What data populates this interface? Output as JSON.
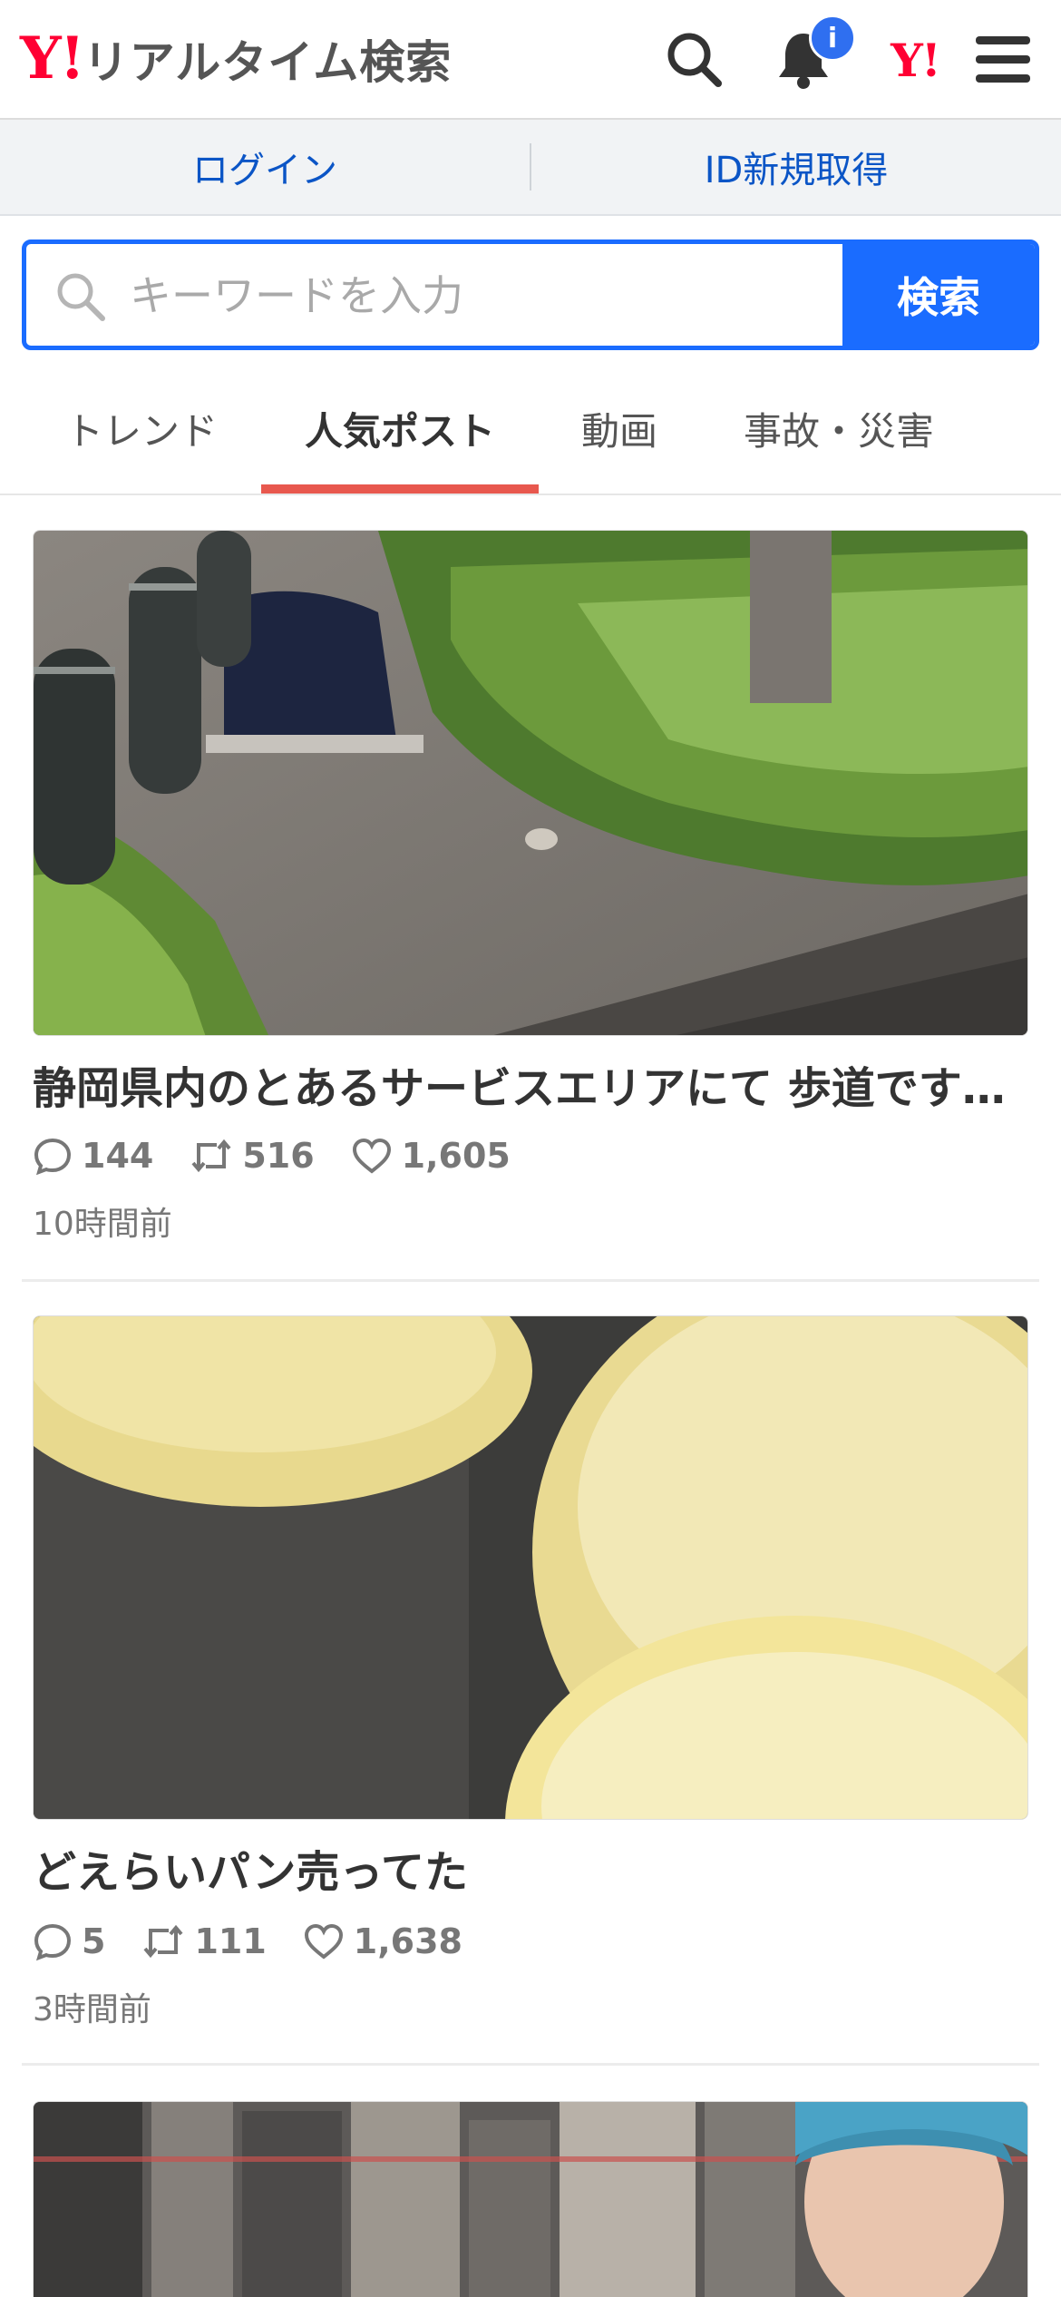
{
  "header": {
    "logo_mark": "Y!",
    "logo_text": "リアルタイム検索",
    "notification_badge": "i",
    "yahoo_mark": "Y!",
    "icons": [
      "search-icon",
      "bell-icon",
      "yahoo-logo-icon",
      "menu-icon"
    ]
  },
  "login_bar": {
    "login_label": "ログイン",
    "register_label": "ID新規取得"
  },
  "search": {
    "placeholder": "キーワードを入力",
    "button_label": "検索"
  },
  "tabs": [
    {
      "label": "トレンド",
      "active": false
    },
    {
      "label": "人気ポスト",
      "active": true
    },
    {
      "label": "動画",
      "active": false
    },
    {
      "label": "事故・災害",
      "active": false
    }
  ],
  "posts": [
    {
      "title": "静岡県内のとあるサービスエリアにて 歩道です…",
      "replies": "144",
      "reposts": "516",
      "likes": "1,605",
      "time": "10時間前"
    },
    {
      "title": "どえらいパン売ってた",
      "replies": "5",
      "reposts": "111",
      "likes": "1,638",
      "time": "3時間前"
    }
  ],
  "colors": {
    "brand_red": "#ff0033",
    "accent_blue": "#1a6cff",
    "link_blue": "#0b55c6",
    "tab_underline": "#e8584e"
  }
}
